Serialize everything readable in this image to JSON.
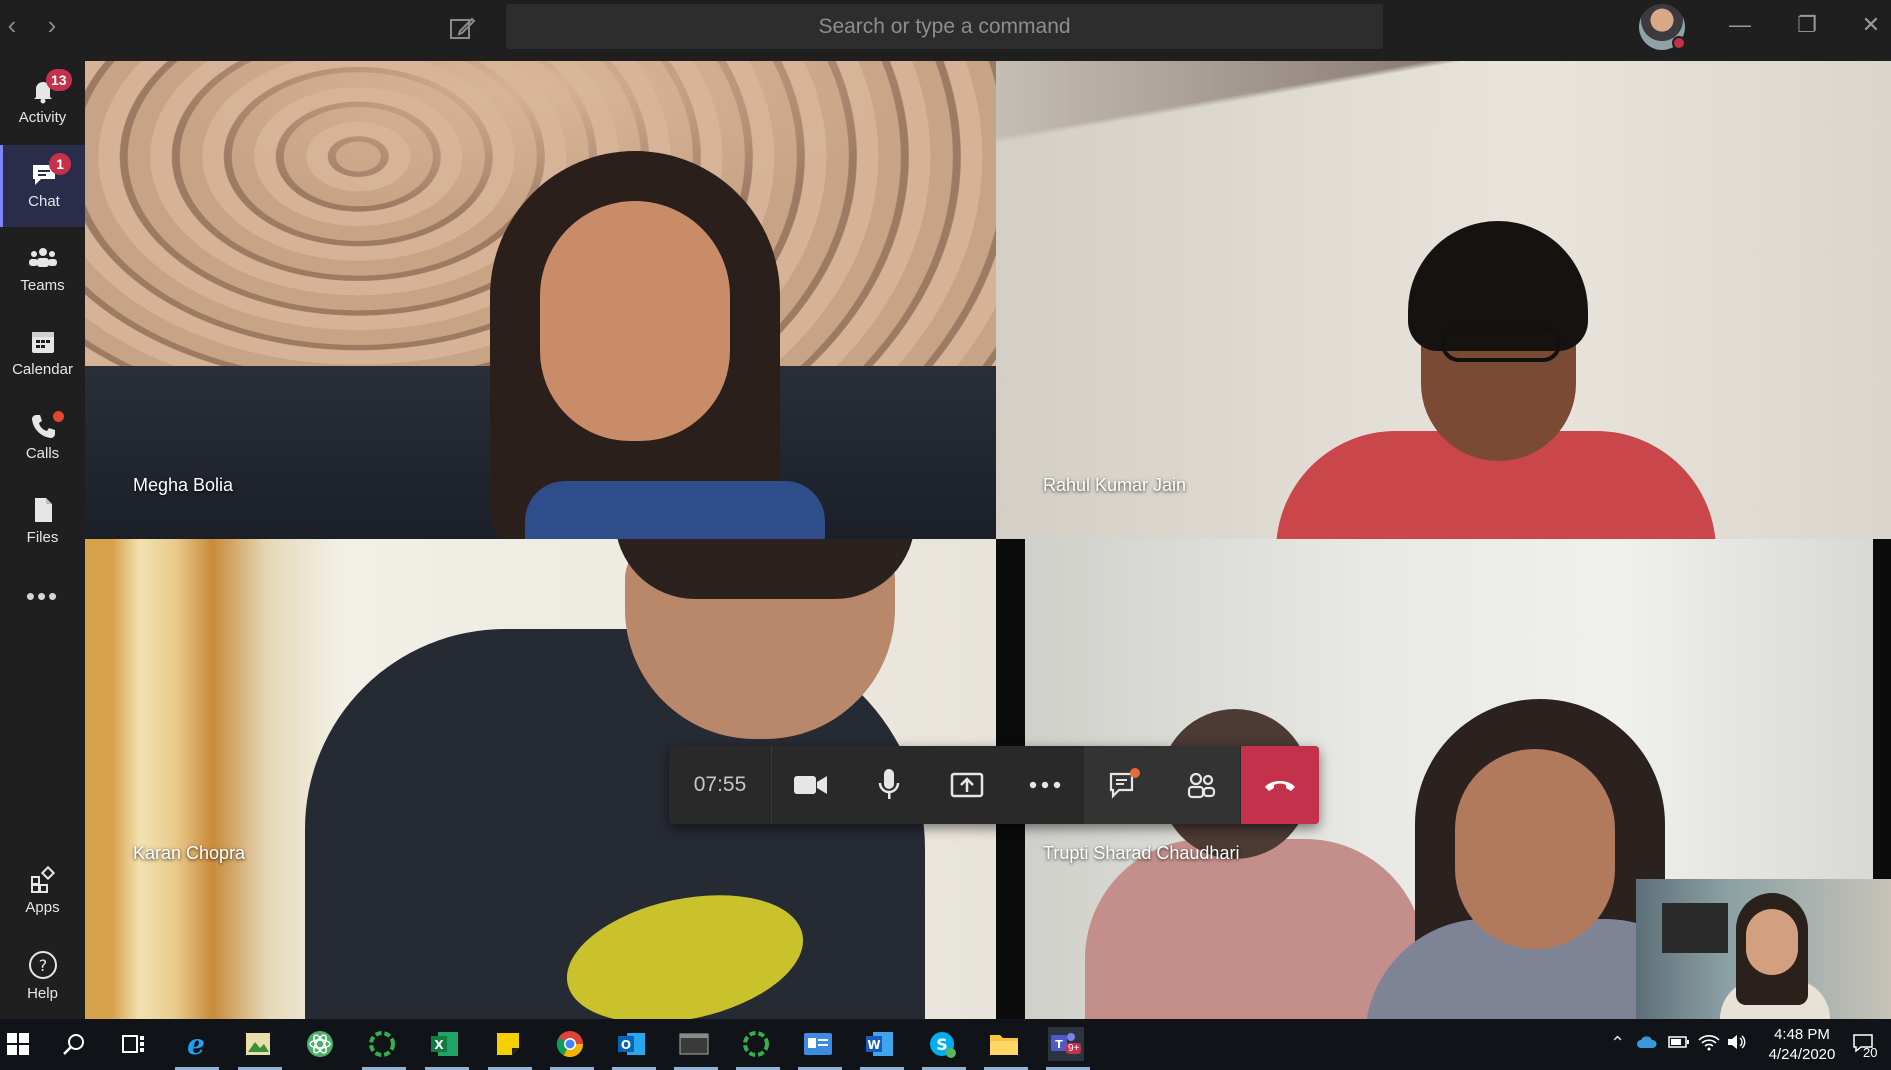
{
  "titlebar": {
    "search_placeholder": "Search or type a command",
    "back_icon": "chevron-left-icon",
    "forward_icon": "chevron-right-icon",
    "compose_icon": "compose-icon",
    "minimize": "—",
    "restore": "❐",
    "close": "✕"
  },
  "rail": {
    "items": [
      {
        "label": "Activity",
        "icon": "bell-icon",
        "badge": "13"
      },
      {
        "label": "Chat",
        "icon": "chat-icon",
        "badge": "1",
        "active": true
      },
      {
        "label": "Teams",
        "icon": "teams-icon"
      },
      {
        "label": "Calendar",
        "icon": "calendar-icon"
      },
      {
        "label": "Calls",
        "icon": "phone-icon",
        "dot": true
      },
      {
        "label": "Files",
        "icon": "files-icon"
      },
      {
        "label": "Apps",
        "icon": "apps-icon"
      },
      {
        "label": "Help",
        "icon": "help-icon"
      }
    ],
    "more": "•••"
  },
  "participants": [
    {
      "name": "Megha Bolia"
    },
    {
      "name": "Rahul Kumar Jain"
    },
    {
      "name": "Karan Chopra"
    },
    {
      "name": "Trupti Sharad Chaudhari"
    }
  ],
  "callbar": {
    "timer": "07:55",
    "buttons": [
      "video-camera-icon",
      "microphone-icon",
      "share-screen-icon",
      "more-options-icon",
      "conversation-icon",
      "participants-icon",
      "hang-up-icon"
    ]
  },
  "taskbar": {
    "time": "4:48 PM",
    "date": "4/24/2020",
    "notifications": "20",
    "teams_badge": "9+"
  },
  "colors": {
    "accent": "#7f85f5",
    "badge": "#c4314b",
    "hangup": "#c4314b",
    "background": "#1f1f1f"
  }
}
